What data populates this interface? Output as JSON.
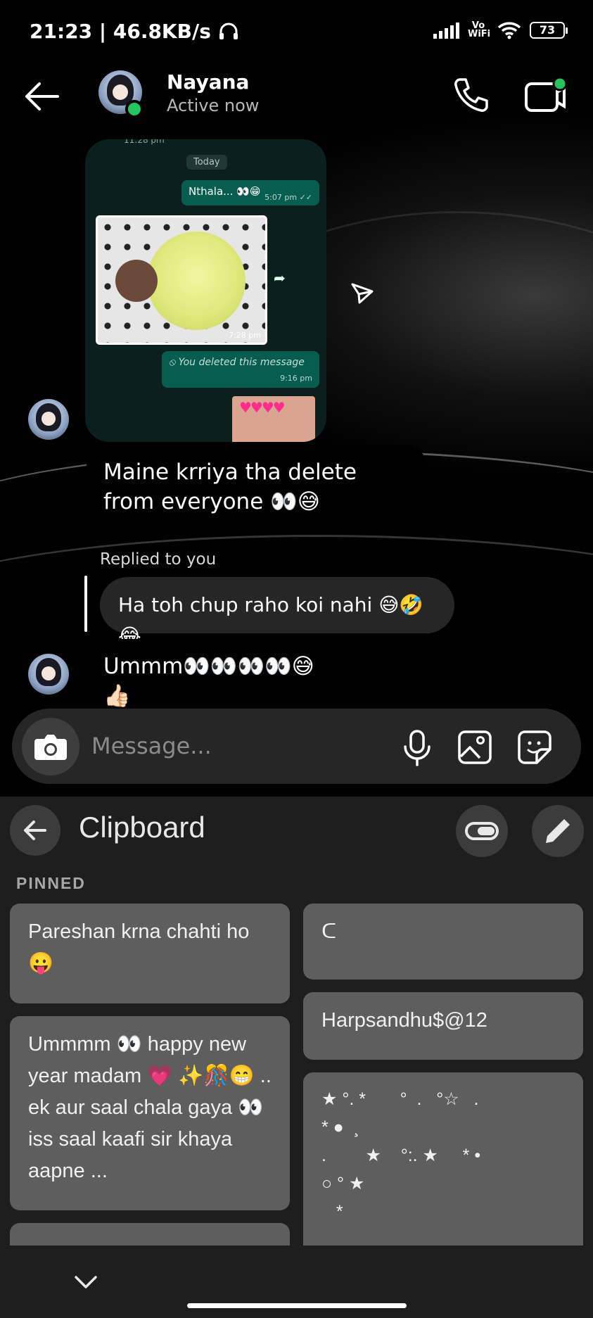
{
  "status_bar": {
    "time": "21:23 | 46.8KB/s",
    "network": "Vo WiFi",
    "battery": "73"
  },
  "header": {
    "name": "Nayana",
    "status": "Active now"
  },
  "shared_screenshot": {
    "top_time": "11:28 pm",
    "date_chip": "Today",
    "msg1_text": "Nthala... 👀😁",
    "msg1_time": "5:07 pm ✓✓",
    "photo_time": "7:28 pm",
    "deleted_text": "⦸ You deleted this message",
    "deleted_time": "9:16 pm"
  },
  "messages": {
    "incoming_1": "Maine krriya tha delete from everyone 👀😅",
    "reply_label": "Replied to you",
    "reply_text": "Ha toh chup raho koi nahi 😅🤣😂",
    "incoming_2": "Ummm👀👀👀👀😅👍🏻"
  },
  "composer": {
    "placeholder": "Message..."
  },
  "clipboard": {
    "title": "Clipboard",
    "pinned_label": "PINNED",
    "items_left": [
      "Pareshan krna chahti ho 😛",
      "Ummmm 👀 happy new year madam 💗 ✨🎊😁 .. ek aur saal chala gaya 👀 iss saal kaafi sir khaya aapne ..."
    ],
    "items_right": [
      "ᑕ",
      "Harpsandhu$@12",
      "★ °. *       °  .   °☆   .\n* ●  ¸\n.        ★    °:. ★     * •\n○ ° ★\n   *"
    ]
  },
  "colors": {
    "accent_green": "#22c55e",
    "whatsapp_bubble": "#075e4f",
    "keyboard_bg": "#1e1e1e",
    "clip_bg": "#5e5e5e"
  },
  "icons": [
    "back-arrow-icon",
    "phone-icon",
    "video-call-icon",
    "send-icon",
    "camera-icon",
    "mic-icon",
    "gallery-icon",
    "sticker-icon",
    "toggle-icon",
    "pencil-icon",
    "chevron-down-icon"
  ]
}
